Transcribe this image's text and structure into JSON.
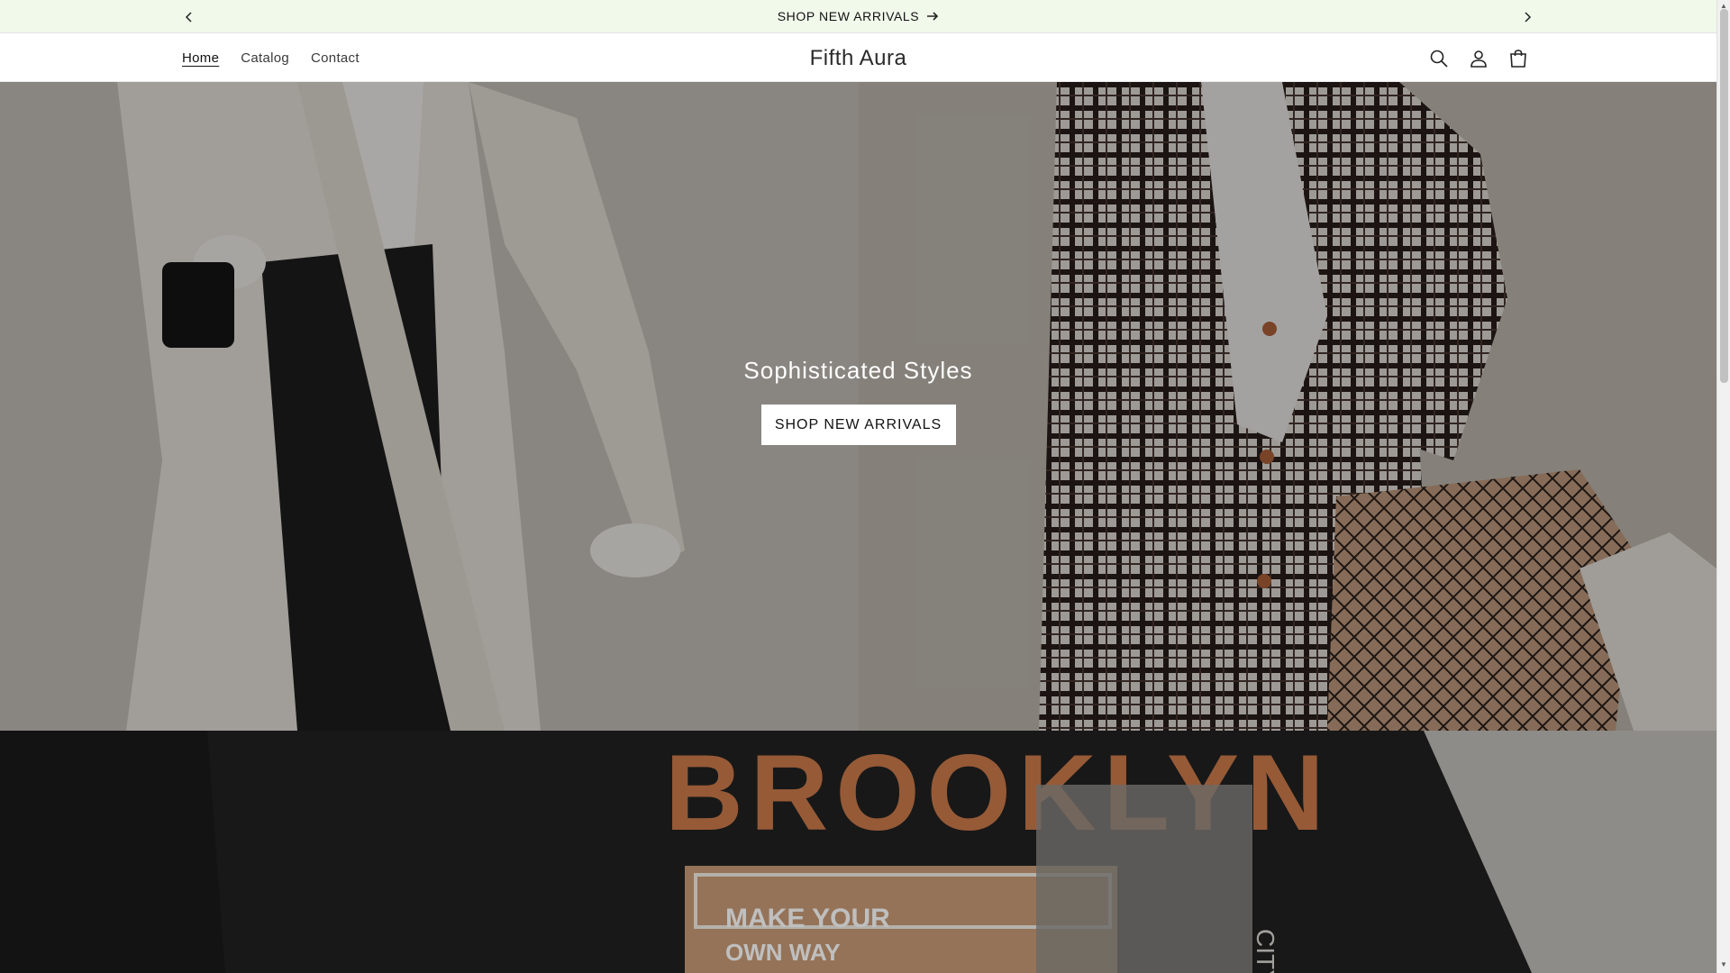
{
  "announcement": {
    "text": "SHOP NEW ARRIVALS"
  },
  "header": {
    "brand": "Fifth Aura",
    "nav": [
      {
        "label": "Home",
        "active": true
      },
      {
        "label": "Catalog",
        "active": false
      },
      {
        "label": "Contact",
        "active": false
      }
    ],
    "icons": [
      "search-icon",
      "account-icon",
      "cart-icon"
    ]
  },
  "hero": {
    "heading": "Sophisticated Styles",
    "button_label": "SHOP NEW ARRIVALS"
  },
  "banner2": {
    "title": "BROOKLYN",
    "line1": "MAKE YOUR",
    "line2": "OWN WAY",
    "side_text": "CITY"
  },
  "colors": {
    "announcement_bg": "#f1f9eb",
    "overlay": "#000000",
    "banner_text": "#c8794a"
  }
}
